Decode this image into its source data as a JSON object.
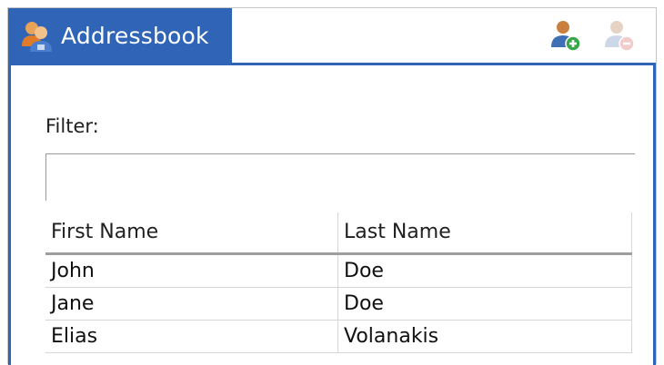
{
  "tab": {
    "label": "Addressbook",
    "icon": "addressbook-icon"
  },
  "toolbar": {
    "add_icon": "add-contact-icon",
    "remove_icon": "remove-contact-icon"
  },
  "filter": {
    "label": "Filter:",
    "value": "",
    "placeholder": ""
  },
  "table": {
    "columns": [
      "First Name",
      "Last Name"
    ],
    "rows": [
      [
        "John",
        "Doe"
      ],
      [
        "Jane",
        "Doe"
      ],
      [
        "Elias",
        "Volanakis"
      ]
    ]
  },
  "colors": {
    "accent": "#3064b6",
    "tab_text": "#ffffff"
  }
}
